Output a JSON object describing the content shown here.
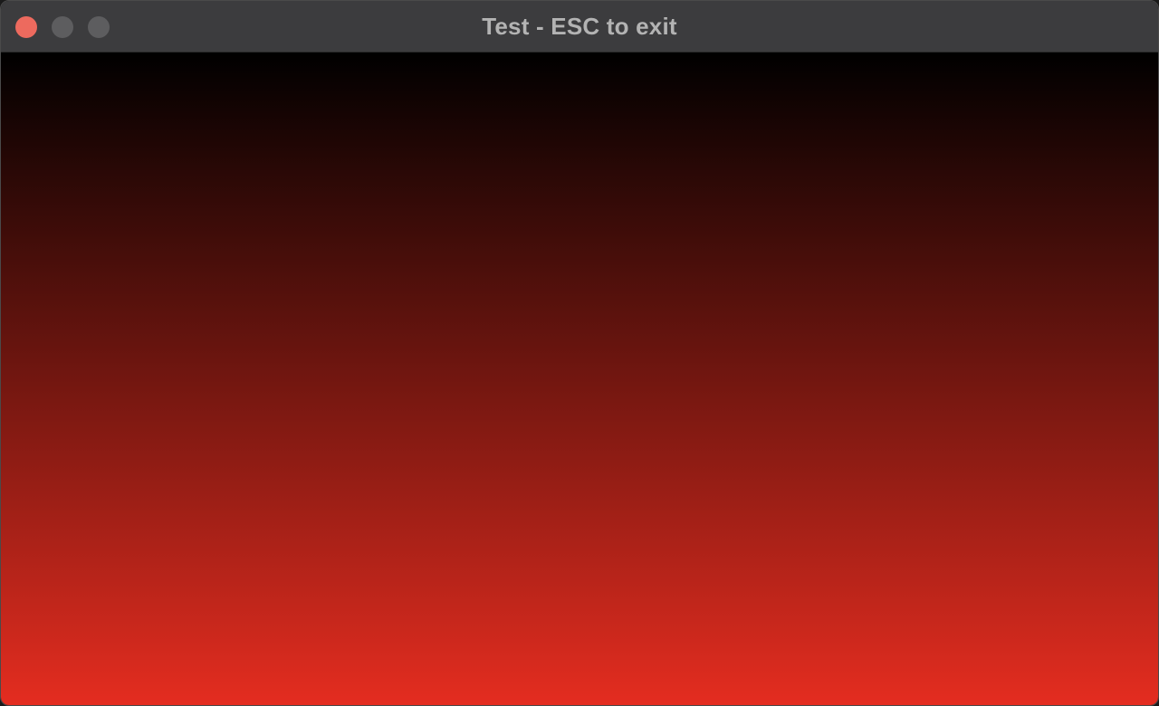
{
  "window": {
    "title": "Test - ESC to exit"
  },
  "traffic_lights": {
    "close_color": "#ed6a5e",
    "minimize_color": "#5d5d5f",
    "zoom_color": "#5d5d5f"
  },
  "content": {
    "gradient_top_color": "#000000",
    "gradient_bottom_color": "#e52d20"
  }
}
